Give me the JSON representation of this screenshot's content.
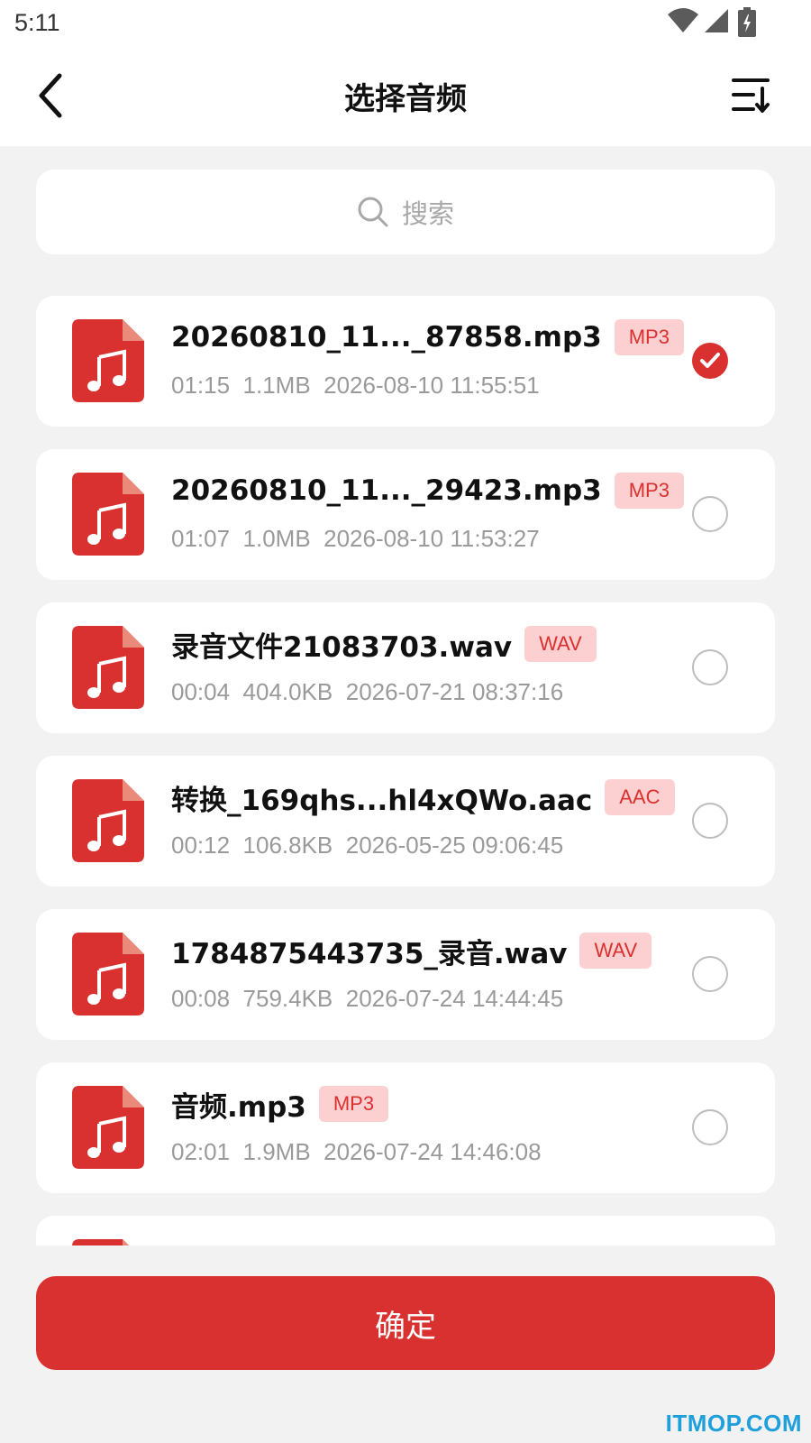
{
  "status_bar": {
    "time": "5:11"
  },
  "header": {
    "title": "选择音频"
  },
  "search": {
    "placeholder": "搜索"
  },
  "files": [
    {
      "name": "20260810_11..._87858.mp3",
      "format": "MP3",
      "duration": "01:15",
      "size": "1.1MB",
      "datetime": "2026-08-10 11:55:51",
      "selected": true
    },
    {
      "name": "20260810_11..._29423.mp3",
      "format": "MP3",
      "duration": "01:07",
      "size": "1.0MB",
      "datetime": "2026-08-10 11:53:27",
      "selected": false
    },
    {
      "name": "录音文件21083703.wav",
      "format": "WAV",
      "duration": "00:04",
      "size": "404.0KB",
      "datetime": "2026-07-21 08:37:16",
      "selected": false
    },
    {
      "name": "转换_169qhs...hl4xQWo.aac",
      "format": "AAC",
      "duration": "00:12",
      "size": "106.8KB",
      "datetime": "2026-05-25 09:06:45",
      "selected": false
    },
    {
      "name": "1784875443735_录音.wav",
      "format": "WAV",
      "duration": "00:08",
      "size": "759.4KB",
      "datetime": "2026-07-24 14:44:45",
      "selected": false
    },
    {
      "name": "音频.mp3",
      "format": "MP3",
      "duration": "02:01",
      "size": "1.9MB",
      "datetime": "2026-07-24 14:46:08",
      "selected": false
    }
  ],
  "confirm": {
    "label": "确定"
  },
  "watermark": {
    "text": "ITMOP.COM"
  },
  "colors": {
    "accent": "#d9312f",
    "badge_bg": "#fcd0d0",
    "background": "#f2f2f2"
  },
  "icons": {
    "back": "chevron-left-icon",
    "sort": "sort-icon",
    "search": "search-icon",
    "file": "music-file-icon",
    "check": "check-icon"
  }
}
